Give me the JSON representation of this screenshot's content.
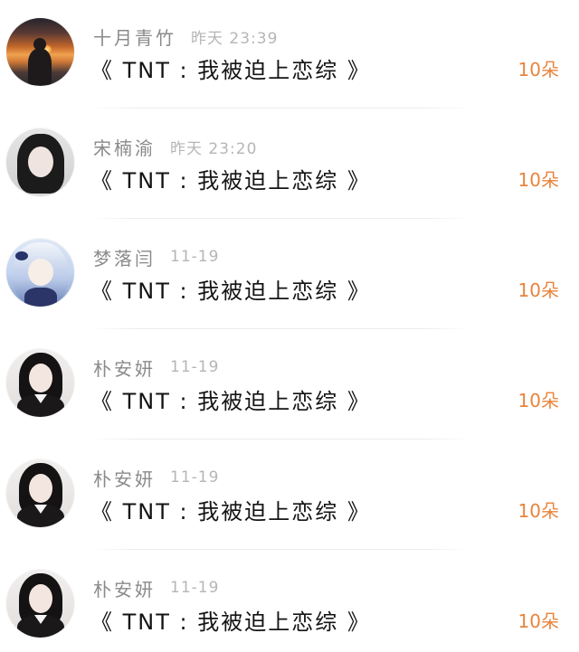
{
  "colors": {
    "username": "#8a8a8a",
    "time": "#b6b6b6",
    "title": "#141414",
    "gift": "#e8843c"
  },
  "list": {
    "items": [
      {
        "username": "十月青竹",
        "time": "昨天 23:39",
        "title": "《 TNT : 我被迫上恋综 》",
        "gift": "10朵",
        "avatar": "sunset-silhouette-avatar"
      },
      {
        "username": "宋楠渝",
        "time": "昨天 23:20",
        "title": "《 TNT : 我被迫上恋综 》",
        "gift": "10朵",
        "avatar": "portrait-avatar"
      },
      {
        "username": "梦落闫",
        "time": "11-19",
        "title": "《 TNT : 我被迫上恋综 》",
        "gift": "10朵",
        "avatar": "anime-avatar"
      },
      {
        "username": "朴安妍",
        "time": "11-19",
        "title": "《 TNT : 我被迫上恋综 》",
        "gift": "10朵",
        "avatar": "portrait-avatar"
      },
      {
        "username": "朴安妍",
        "time": "11-19",
        "title": "《 TNT : 我被迫上恋综 》",
        "gift": "10朵",
        "avatar": "portrait-avatar"
      },
      {
        "username": "朴安妍",
        "time": "11-19",
        "title": "《 TNT : 我被迫上恋综 》",
        "gift": "10朵",
        "avatar": "portrait-avatar"
      }
    ]
  }
}
